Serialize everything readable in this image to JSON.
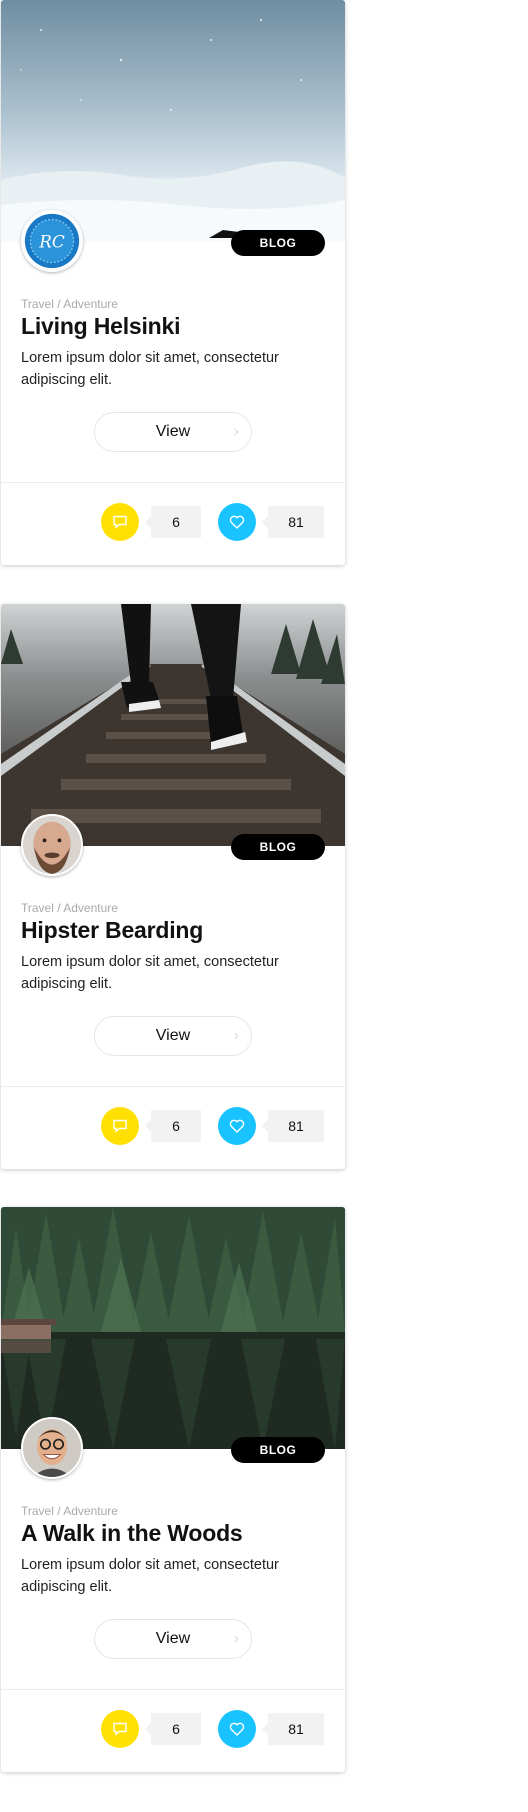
{
  "cards": [
    {
      "badge": "BLOG",
      "category": "Travel / Adventure",
      "title": "Living Helsinki",
      "excerpt": "Lorem ipsum dolor sit amet, consectetur adipiscing elit.",
      "view_label": "View",
      "comments": "6",
      "likes": "81",
      "cover": "snowy-landscape",
      "avatar": "blue-emblem-logo"
    },
    {
      "badge": "BLOG",
      "category": "Travel / Adventure",
      "title": "Hipster Bearding",
      "excerpt": "Lorem ipsum dolor sit amet, consectetur adipiscing elit.",
      "view_label": "View",
      "comments": "6",
      "likes": "81",
      "cover": "railway-sneakers",
      "avatar": "bearded-man"
    },
    {
      "badge": "BLOG",
      "category": "Travel / Adventure",
      "title": "A Walk in the Woods",
      "excerpt": "Lorem ipsum dolor sit amet, consectetur adipiscing elit.",
      "view_label": "View",
      "comments": "6",
      "likes": "81",
      "cover": "forest-lake",
      "avatar": "smiling-man-glasses"
    }
  ],
  "colors": {
    "comment_accent": "#ffe000",
    "like_accent": "#19c3ff",
    "badge": "#000000"
  }
}
